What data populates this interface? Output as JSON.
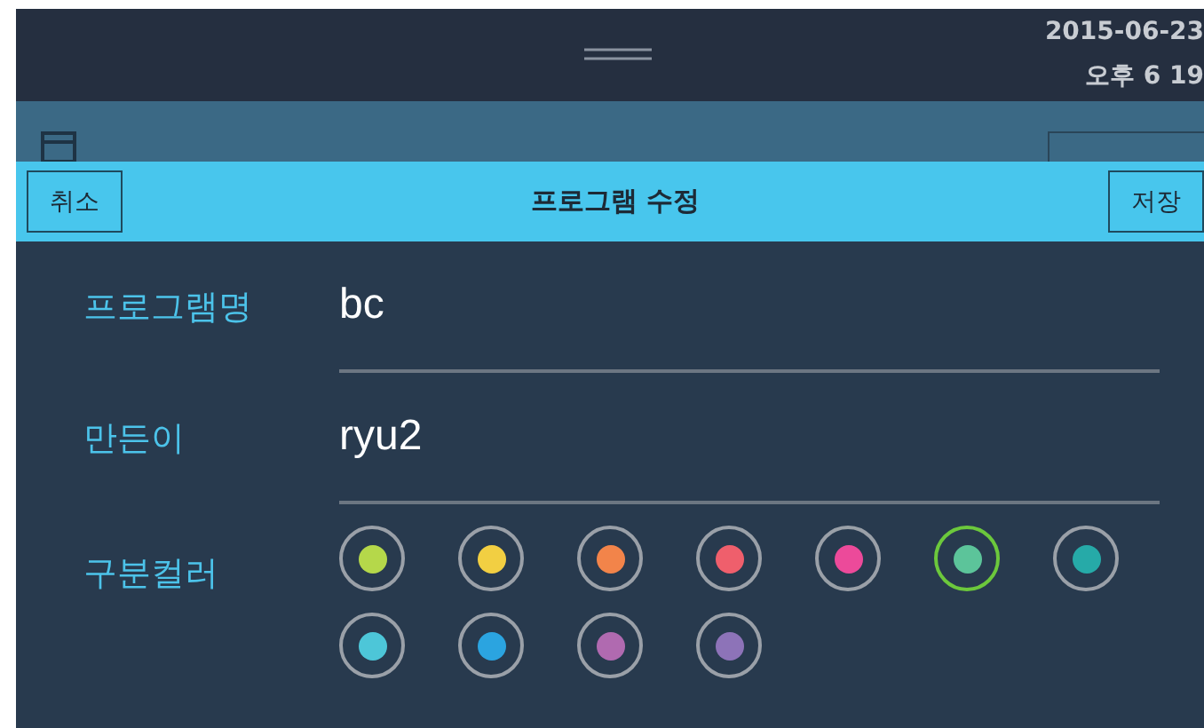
{
  "status_bar": {
    "date": "2015-06-23",
    "time": "오후 6  19"
  },
  "dialog": {
    "title": "프로그램 수정",
    "cancel": "취소",
    "save": "저장",
    "fields": [
      {
        "label": "프로그램명",
        "value": "bc"
      },
      {
        "label": "만든이",
        "value": "ryu2"
      }
    ],
    "color_label": "구분컬러",
    "colors": [
      {
        "color": "#b5d84a",
        "selected": false
      },
      {
        "color": "#f2cf42",
        "selected": false
      },
      {
        "color": "#f2844a",
        "selected": false
      },
      {
        "color": "#ef5f6c",
        "selected": false
      },
      {
        "color": "#ec4a9a",
        "selected": false
      },
      {
        "color": "#5cc49a",
        "selected": true
      },
      {
        "color": "#26aaa8",
        "selected": false
      },
      {
        "color": "#4dc6d8",
        "selected": false
      },
      {
        "color": "#2ba4e0",
        "selected": false
      },
      {
        "color": "#b06ab0",
        "selected": false
      },
      {
        "color": "#8d73b8",
        "selected": false
      }
    ]
  }
}
